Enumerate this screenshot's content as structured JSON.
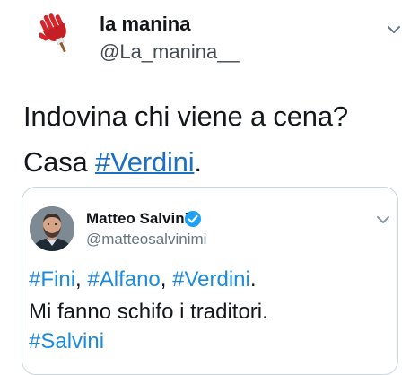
{
  "tweet": {
    "author": {
      "display_name": "la manina",
      "handle": "@La_manina__",
      "avatar_icon": "red-hand-icon"
    },
    "menu_icon": "chevron-down-icon",
    "text_line1": "Indovina chi viene a cena?",
    "text_line2_prefix": "Casa ",
    "text_line2_hashtag": "#Verdini",
    "text_line2_suffix": "."
  },
  "quoted_tweet": {
    "author": {
      "display_name": "Matteo Salvini",
      "handle": "@matteosalvinimi",
      "verified_icon": "verified-badge-icon"
    },
    "menu_icon": "chevron-down-icon",
    "line1": {
      "tag1": "#Fini",
      "sep1": ", ",
      "tag2": "#Alfano",
      "sep2": ", ",
      "tag3": "#Verdini",
      "end": "."
    },
    "line2": "Mi fanno schifo i traditori.",
    "line3_tag": "#Salvini"
  },
  "colors": {
    "link": "#1b6fc2",
    "quote_link": "#1b8be0",
    "verified": "#1da1f2",
    "hand": "#d6262b"
  }
}
